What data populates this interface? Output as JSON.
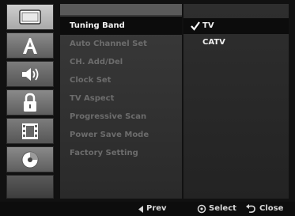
{
  "sidebar": {
    "icons": [
      {
        "name": "tv-icon"
      },
      {
        "name": "language-a-icon"
      },
      {
        "name": "audio-speaker-icon"
      },
      {
        "name": "lock-icon"
      },
      {
        "name": "film-icon"
      },
      {
        "name": "disc-icon"
      }
    ]
  },
  "menu": {
    "items": [
      {
        "label": "Tuning Band"
      },
      {
        "label": "Auto Channel Set"
      },
      {
        "label": "CH. Add/Del"
      },
      {
        "label": "Clock Set"
      },
      {
        "label": "TV Aspect"
      },
      {
        "label": "Progressive Scan"
      },
      {
        "label": "Power Save Mode"
      },
      {
        "label": "Factory Setting"
      }
    ]
  },
  "options": {
    "items": [
      {
        "label": "TV",
        "checked": true
      },
      {
        "label": "CATV",
        "checked": false
      }
    ]
  },
  "footer": {
    "prev_label": "Prev",
    "select_label": "Select",
    "close_label": "Close"
  },
  "colors": {
    "highlight_bg": "#0c0c0c",
    "text_active": "#f2f2f2",
    "text_inactive": "#6c6c6c"
  }
}
